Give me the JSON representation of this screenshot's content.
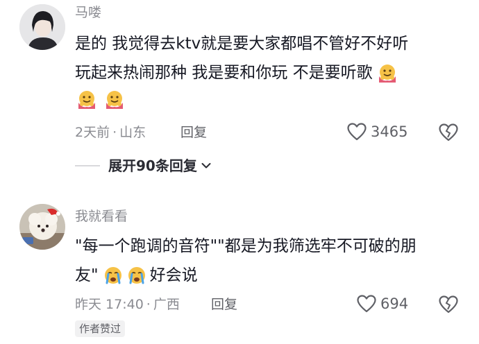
{
  "comments": [
    {
      "username": "马喽",
      "text_line1": "是的 我觉得去ktv就是要大家都唱不管好不好听",
      "text_line2": "玩起来热闹那种 我是要和你玩 不是要听歌",
      "emoji_hug": "hug-emoji",
      "time": "2天前",
      "location": "山东",
      "reply_label": "回复",
      "likes": "3465",
      "expand_label": "展开90条回复",
      "colors": {
        "accent": "#161823",
        "muted": "#8a8b91"
      }
    },
    {
      "username": "我就看看",
      "text_line1": "\"每一个跑调的音符\"\"都是为我筛选牢不可破的朋",
      "text_line2_prefix": "友\"",
      "text_line2_suffix": "好会说",
      "emoji_cry": "crying-emoji",
      "time": "昨天 17:40",
      "location": "广西",
      "reply_label": "回复",
      "likes": "694",
      "badge": "作者赞过"
    }
  ],
  "separator": "·"
}
